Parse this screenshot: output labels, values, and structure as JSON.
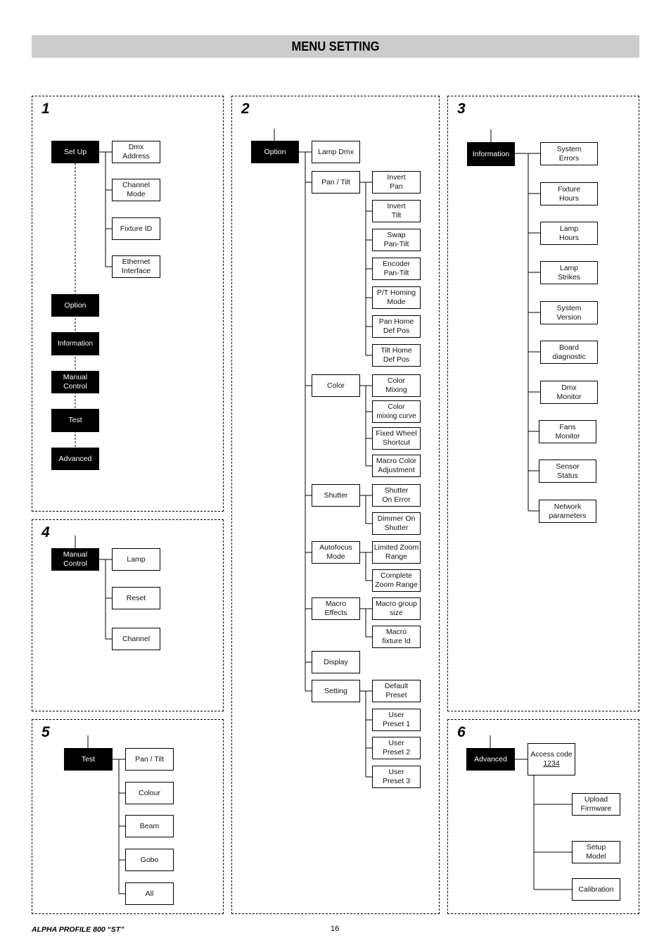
{
  "header": {
    "title": "MENU SETTING"
  },
  "footer": {
    "product": "ALPHA PROFILE 800 “ST”",
    "page_number": "16"
  },
  "colors": {
    "title_bar": "#cccccc",
    "root_box": "#000000",
    "child_box": "#ffffff"
  },
  "panels": [
    {
      "number": "1",
      "root": "Set Up",
      "children": [
        "Dmx\nAddress",
        "Channel\nMode",
        "Fixture ID",
        "Ethernet\nInterface"
      ],
      "main_menu": [
        "Option",
        "Information",
        "Manual\nControl",
        "Test",
        "Advanced"
      ]
    },
    {
      "number": "2",
      "root": "Option",
      "children": [
        {
          "label": "Lamp Dmx",
          "children": []
        },
        {
          "label": "Pan / Tilt",
          "children": [
            "Invert\nPan",
            "Invert\nTilt",
            "Swap\nPan-Tilt",
            "Encoder\nPan-Tilt",
            "P/T Homing\nMode",
            "Pan Home\nDef Pos",
            "Tilt Home\nDef Pos"
          ]
        },
        {
          "label": "Color",
          "children": [
            "Color\nMixing",
            "Color\nmixing curve",
            "Fixed Wheel\nShortcut",
            "Macro Color\nAdjustment"
          ]
        },
        {
          "label": "Shutter",
          "children": [
            "Shutter\nOn Error",
            "Dimmer On\nShutter"
          ]
        },
        {
          "label": "Autofocus\nMode",
          "children": [
            "Limited Zoom\nRange",
            "Complete\nZoom Range"
          ]
        },
        {
          "label": "Macro\nEffects",
          "children": [
            "Macro group\nsize",
            "Macro\nfixture Id"
          ]
        },
        {
          "label": "Display",
          "children": []
        },
        {
          "label": "Setting",
          "children": [
            "Default\nPreset",
            "User\nPreset 1",
            "User\nPreset 2",
            "User\nPreset 3"
          ]
        }
      ]
    },
    {
      "number": "3",
      "root": "Information",
      "children": [
        "System\nErrors",
        "Fixture\nHours",
        "Lamp\nHours",
        "Lamp\nStrikes",
        "System\nVersion",
        "Board\ndiagnostic",
        "Dmx\nMonitor",
        "Fans\nMonitor",
        "Sensor\nStatus",
        "Network\nparameters"
      ]
    },
    {
      "number": "4",
      "root": "Manual\nControl",
      "children": [
        "Lamp",
        "Reset",
        "Channel"
      ]
    },
    {
      "number": "5",
      "root": "Test",
      "children": [
        "Pan / Tilt",
        "Colour",
        "Beam",
        "Gobo",
        "All"
      ]
    },
    {
      "number": "6",
      "root": "Advanced",
      "access": {
        "label": "Access code",
        "code": "1234"
      },
      "children": [
        "Upload\nFirmware",
        "Setup\nModel",
        "Calibration"
      ]
    }
  ]
}
